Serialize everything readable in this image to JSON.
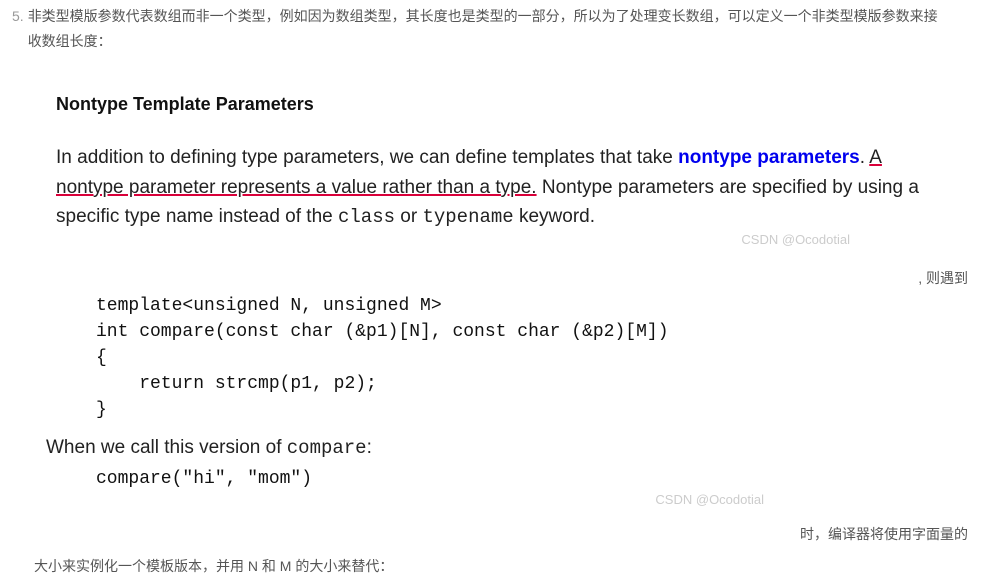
{
  "list": {
    "number": "5.",
    "text": "非类型模版参数代表数组而非一个类型，例如因为数组类型，其长度也是类型的一部分，所以为了处理变长数组，可以定义一个非类型模版参数来接收数组长度："
  },
  "heading": "Nontype Template Parameters",
  "para1": {
    "t1": "In addition to defining type parameters, we can define templates that take ",
    "t2": "nontype parameters",
    "t3": ". ",
    "t4": "A nontype parameter represents a value rather than a type.",
    "t5": " Nontype parameters are specified by using a specific type name instead of the ",
    "t6": "class",
    "t7": " or ",
    "t8": "typename",
    "t9": " keyword."
  },
  "watermark": "CSDN @Ocodotial",
  "right1": ", 则遇到",
  "code1": "template<unsigned N, unsigned M>\nint compare(const char (&p1)[N], const char (&p2)[M])\n{\n    return strcmp(p1, p2);\n}",
  "para2": {
    "t1": "When we call this version of ",
    "t2": "compare",
    "t3": ":"
  },
  "code2": "compare(\"hi\", \"mom\")",
  "right2": "时，编译器将使用字面量的",
  "bottom": "大小来实例化一个模板版本，并用 N 和 M 的大小来替代："
}
